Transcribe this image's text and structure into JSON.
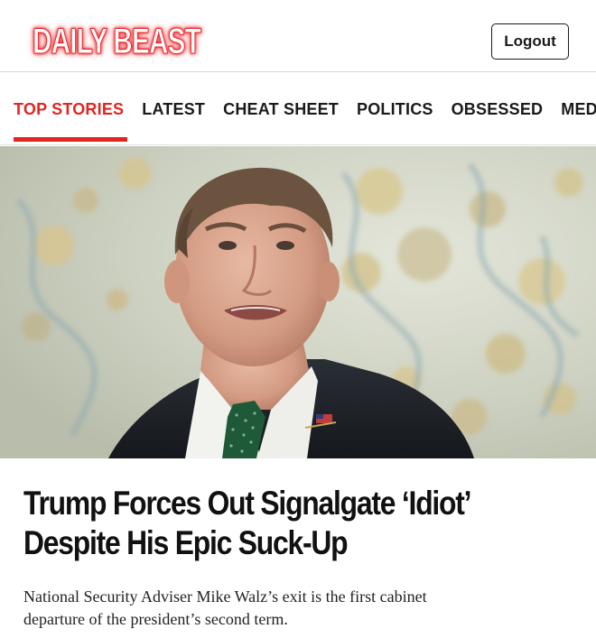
{
  "header": {
    "logo_text": "DAILY BEAST",
    "logout_label": "Logout"
  },
  "nav": {
    "tabs": [
      {
        "label": "TOP STORIES",
        "active": true
      },
      {
        "label": "LATEST",
        "active": false
      },
      {
        "label": "CHEAT SHEET",
        "active": false
      },
      {
        "label": "POLITICS",
        "active": false
      },
      {
        "label": "OBSESSED",
        "active": false
      },
      {
        "label": "MED",
        "active": false
      }
    ]
  },
  "article": {
    "headline_line1": "Trump Forces Out Signalgate ‘Idiot’",
    "headline_line2": "Despite His Epic Suck-Up",
    "dek_line1": "National Security Adviser Mike Walz’s exit is the first cabinet",
    "dek_line2": "departure of the president’s second term."
  },
  "colors": {
    "brand_red": "#e0261f",
    "text": "#111111"
  }
}
